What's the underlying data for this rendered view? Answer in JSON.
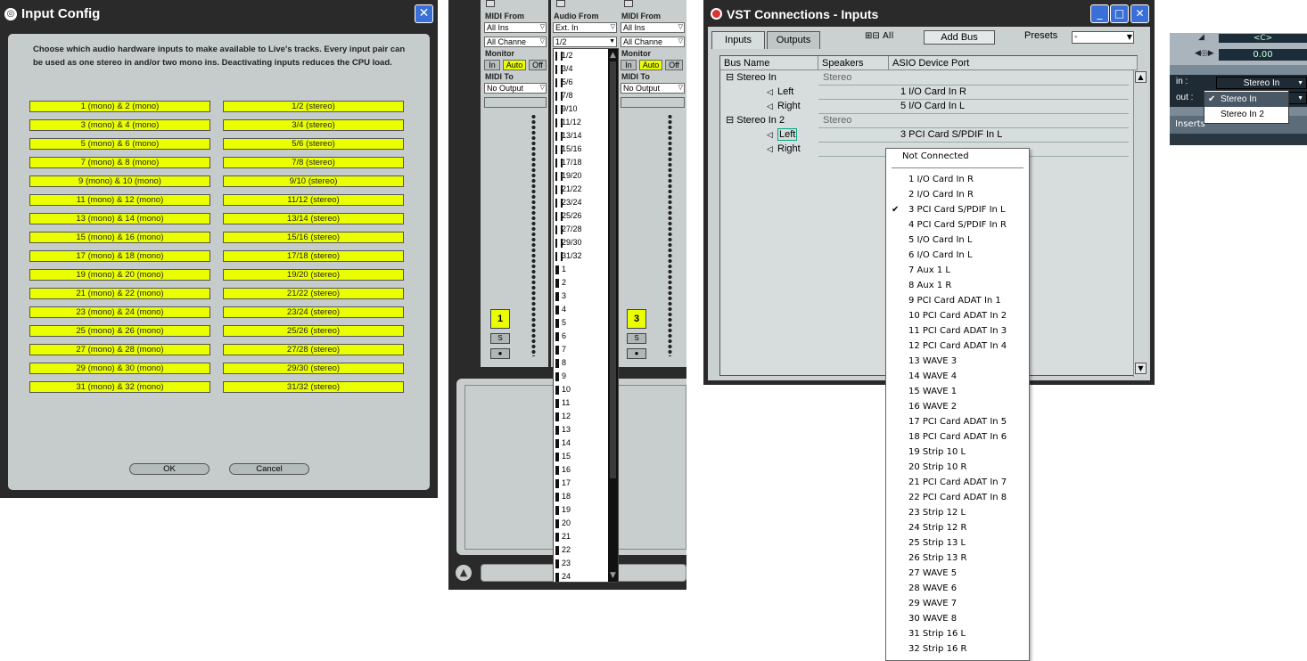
{
  "input_config": {
    "title": "Input Config",
    "description": "Choose which audio hardware inputs to make available to Live's tracks. Every input pair can be used as one stereo in and/or two mono ins.  Deactivating inputs reduces the CPU load.",
    "mono_pairs": [
      "1 (mono) & 2 (mono)",
      "3 (mono) & 4 (mono)",
      "5 (mono) & 6 (mono)",
      "7 (mono) & 8 (mono)",
      "9 (mono) & 10 (mono)",
      "11 (mono) & 12 (mono)",
      "13 (mono) & 14 (mono)",
      "15 (mono) & 16 (mono)",
      "17 (mono) & 18 (mono)",
      "19 (mono) & 20 (mono)",
      "21 (mono) & 22 (mono)",
      "23 (mono) & 24 (mono)",
      "25 (mono) & 26 (mono)",
      "27 (mono) & 28 (mono)",
      "29 (mono) & 30 (mono)",
      "31 (mono) & 32 (mono)"
    ],
    "stereo_pairs": [
      "1/2 (stereo)",
      "3/4 (stereo)",
      "5/6 (stereo)",
      "7/8 (stereo)",
      "9/10 (stereo)",
      "11/12 (stereo)",
      "13/14 (stereo)",
      "15/16 (stereo)",
      "17/18 (stereo)",
      "19/20 (stereo)",
      "21/22 (stereo)",
      "23/24 (stereo)",
      "25/26 (stereo)",
      "27/28 (stereo)",
      "29/30 (stereo)",
      "31/32 (stereo)"
    ],
    "ok_label": "OK",
    "cancel_label": "Cancel",
    "accent_color": "#eaff00"
  },
  "live_mixer": {
    "strip1": {
      "midi_from_label": "MIDI From",
      "midi_from": "All Ins",
      "channel": "All Channe",
      "monitor_label": "Monitor",
      "mon_in": "In",
      "mon_auto": "Auto",
      "mon_off": "Off",
      "midi_to_label": "MIDI To",
      "midi_to": "No Output",
      "track_number": "1",
      "solo": "S"
    },
    "strip2": {
      "audio_from_label": "Audio From",
      "audio_from": "Ext. In",
      "channel": "1/2"
    },
    "strip3": {
      "midi_from_label": "MIDI From",
      "midi_from": "All Ins",
      "channel": "All Channe",
      "monitor_label": "Monitor",
      "mon_in": "In",
      "mon_auto": "Auto",
      "mon_off": "Off",
      "midi_to_label": "MIDI To",
      "midi_to": "No Output",
      "track_number": "3",
      "solo": "S"
    },
    "channel_list_stereo": [
      "1/2",
      "3/4",
      "5/6",
      "7/8",
      "9/10",
      "11/12",
      "13/14",
      "15/16",
      "17/18",
      "19/20",
      "21/22",
      "23/24",
      "25/26",
      "27/28",
      "29/30",
      "31/32"
    ],
    "channel_list_mono": [
      "1",
      "2",
      "3",
      "4",
      "5",
      "6",
      "7",
      "8",
      "9",
      "10",
      "11",
      "12",
      "13",
      "14",
      "15",
      "16",
      "17",
      "18",
      "19",
      "20",
      "21",
      "22",
      "23",
      "24"
    ]
  },
  "vst_connections": {
    "title": "VST Connections - Inputs",
    "tabs": [
      "Inputs",
      "Outputs"
    ],
    "all_label": "All",
    "add_bus_label": "Add Bus",
    "presets_label": "Presets",
    "presets_value": "-",
    "columns": [
      "Bus Name",
      "Speakers",
      "ASIO Device Port"
    ],
    "rows": [
      {
        "name": "Stereo In",
        "speakers": "Stereo",
        "port": ""
      },
      {
        "name": "Left",
        "speakers": "",
        "port": "1 I/O Card In R"
      },
      {
        "name": "Right",
        "speakers": "",
        "port": "5 I/O Card In L"
      },
      {
        "name": "Stereo In 2",
        "speakers": "Stereo",
        "port": ""
      },
      {
        "name": "Left",
        "speakers": "",
        "port": "3 PCI Card S/PDIF In L"
      },
      {
        "name": "Right",
        "speakers": "",
        "port": ""
      }
    ],
    "menu_header": "Not Connected",
    "menu_items": [
      "1 I/O Card In R",
      "2 I/O Card In R",
      "3 PCI Card S/PDIF In L",
      "4 PCI Card S/PDIF In R",
      "5 I/O Card In L",
      "6 I/O Card In L",
      "7 Aux 1 L",
      "8 Aux 1 R",
      "9 PCI Card ADAT In 1",
      "10 PCI Card ADAT In 2",
      "11 PCI Card ADAT In 3",
      "12 PCI Card ADAT In 4",
      "13 WAVE 3",
      "14 WAVE 4",
      "15 WAVE 1",
      "16 WAVE 2",
      "17 PCI Card ADAT In 5",
      "18 PCI Card ADAT In 6",
      "19 Strip 10  L",
      "20 Strip 10  R",
      "21 PCI Card ADAT In 7",
      "22 PCI Card ADAT In 8",
      "23 Strip 12  L",
      "24 Strip 12  R",
      "25 Strip 13  L",
      "26 Strip 13  R",
      "27 WAVE 5",
      "28 WAVE 6",
      "29 WAVE 7",
      "30 WAVE 8",
      "31 Strip 16  L",
      "32 Strip 16  R"
    ],
    "checked_item": "3 PCI Card S/PDIF In L"
  },
  "cubase_strip": {
    "pan_value": "<C>",
    "delay_value": "0.00",
    "in_label": "in :",
    "in_value": "Stereo In",
    "out_label": "out :",
    "dropdown_items": [
      "Stereo In",
      "Stereo In 2"
    ],
    "selected_item": "Stereo In",
    "inserts_label": "Inserts"
  }
}
